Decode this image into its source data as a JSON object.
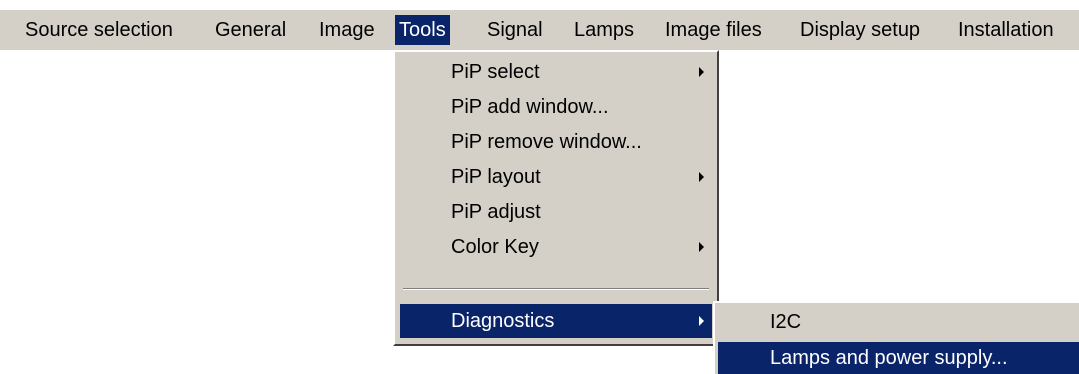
{
  "menubar": {
    "items": [
      {
        "label": "Source selection"
      },
      {
        "label": "General"
      },
      {
        "label": "Image"
      },
      {
        "label": "Tools"
      },
      {
        "label": "Signal"
      },
      {
        "label": "Lamps"
      },
      {
        "label": "Image files"
      },
      {
        "label": "Display setup"
      },
      {
        "label": "Installation"
      }
    ]
  },
  "tools_menu": {
    "items": [
      {
        "label": "PiP select",
        "has_submenu": true
      },
      {
        "label": "PiP add window...",
        "has_submenu": false
      },
      {
        "label": "PiP remove window...",
        "has_submenu": false
      },
      {
        "label": "PiP layout",
        "has_submenu": true
      },
      {
        "label": "PiP adjust",
        "has_submenu": false
      },
      {
        "label": "Color Key",
        "has_submenu": true
      },
      {
        "label": "Diagnostics",
        "has_submenu": true
      }
    ]
  },
  "diagnostics_submenu": {
    "items": [
      {
        "label": "I2C"
      },
      {
        "label": "Lamps and power supply..."
      }
    ]
  },
  "colors": {
    "menu_background": "#d4d0c8",
    "highlight": "#0a246a",
    "highlight_text": "#ffffff"
  },
  "icons": {
    "submenu_arrow": "triangle-right-icon"
  }
}
